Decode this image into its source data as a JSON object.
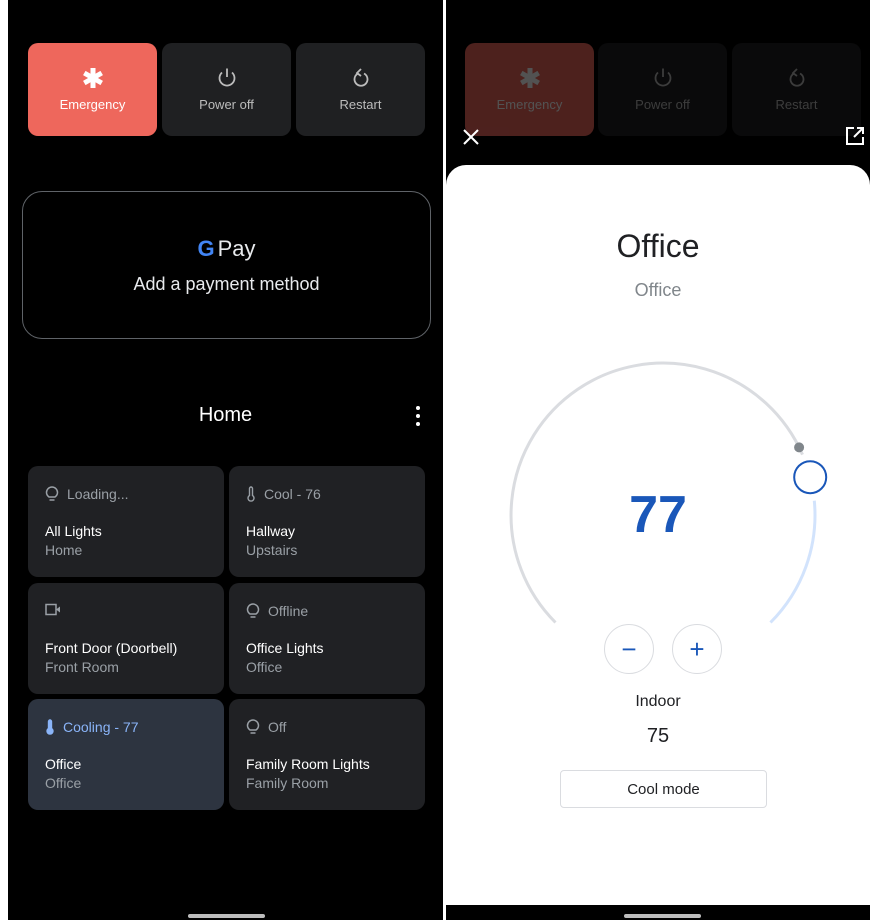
{
  "power_menu": {
    "emergency": "Emergency",
    "power_off": "Power off",
    "restart": "Restart"
  },
  "gpay": {
    "logo_g": "G",
    "logo_text": "Pay",
    "subtitle": "Add a payment method"
  },
  "structure": {
    "title": "Home"
  },
  "tiles": [
    {
      "status": "Loading...",
      "name": "All Lights",
      "room": "Home",
      "icon": "lightbulb-icon"
    },
    {
      "status": "Cool - 76",
      "name": "Hallway",
      "room": "Upstairs",
      "icon": "thermometer-icon"
    },
    {
      "status": "",
      "name": "Front Door (Doorbell)",
      "room": "Front Room",
      "icon": "camera-icon"
    },
    {
      "status": "Offline",
      "name": "Office Lights",
      "room": "Office",
      "icon": "lightbulb-icon"
    },
    {
      "status": "Cooling - 77",
      "name": "Office",
      "room": "Office",
      "icon": "thermometer-icon",
      "active": true
    },
    {
      "status": "Off",
      "name": "Family Room Lights",
      "room": "Family Room",
      "icon": "lightbulb-icon"
    }
  ],
  "detail": {
    "title": "Office",
    "subtitle": "Office",
    "setpoint": "77",
    "setpoint_fraction": 0.78,
    "indoor_label": "Indoor",
    "indoor_value": "75",
    "mode_button": "Cool mode",
    "decrease_symbol": "−",
    "increase_symbol": "+"
  },
  "colors": {
    "emergency": "#ee675c",
    "accent_blue": "#1a57b9",
    "active_tile": "#2d3440",
    "tile": "#202124"
  }
}
